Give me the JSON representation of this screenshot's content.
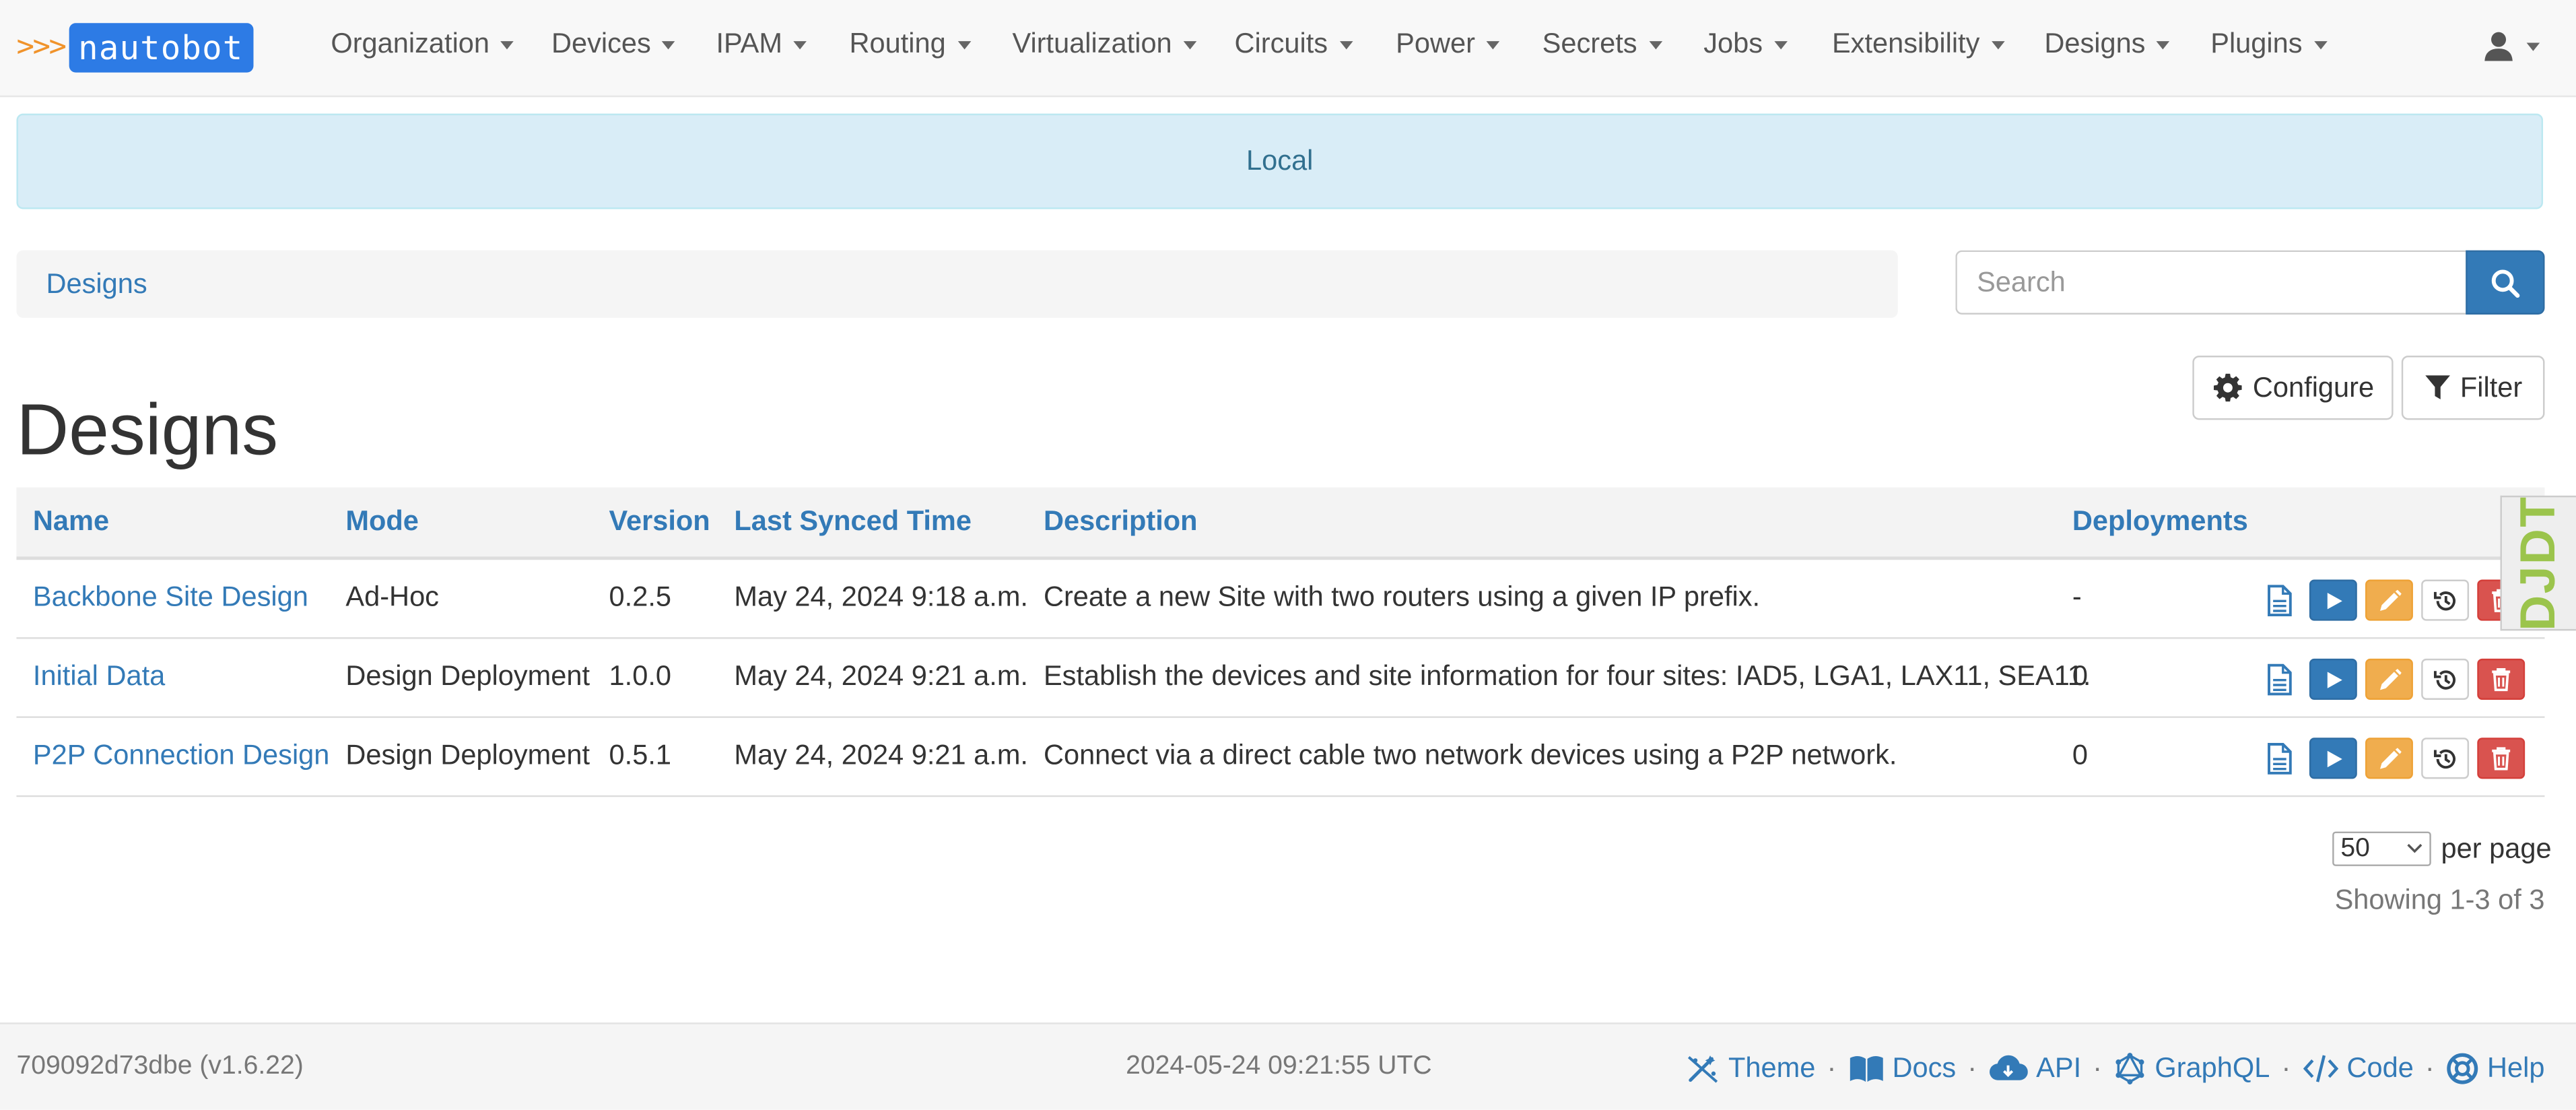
{
  "brand": {
    "arrows": ">>>",
    "name": "nautobot"
  },
  "nav": {
    "items": [
      {
        "label": "Organization"
      },
      {
        "label": "Devices"
      },
      {
        "label": "IPAM"
      },
      {
        "label": "Routing"
      },
      {
        "label": "Virtualization"
      },
      {
        "label": "Circuits"
      },
      {
        "label": "Power"
      },
      {
        "label": "Secrets"
      },
      {
        "label": "Jobs"
      },
      {
        "label": "Extensibility"
      },
      {
        "label": "Designs"
      },
      {
        "label": "Plugins"
      }
    ]
  },
  "banner": {
    "text": "Local"
  },
  "breadcrumb": {
    "items": [
      {
        "label": "Designs"
      }
    ]
  },
  "search": {
    "placeholder": "Search"
  },
  "toolbar": {
    "configure_label": "Configure",
    "filter_label": "Filter"
  },
  "page": {
    "title": "Designs"
  },
  "table": {
    "columns": [
      "Name",
      "Mode",
      "Version",
      "Last Synced Time",
      "Description",
      "Deployments"
    ],
    "rows": [
      {
        "name": "Backbone Site Design",
        "mode": "Ad-Hoc",
        "version": "0.2.5",
        "synced": "May 24, 2024 9:18 a.m.",
        "description": "Create a new Site with two routers using a given IP prefix.",
        "deployments": "-"
      },
      {
        "name": "Initial Data",
        "mode": "Design Deployment",
        "version": "1.0.0",
        "synced": "May 24, 2024 9:21 a.m.",
        "description": "Establish the devices and site information for four sites: IAD5, LGA1, LAX11, SEA11.",
        "deployments": "0"
      },
      {
        "name": "P2P Connection Design",
        "mode": "Design Deployment",
        "version": "0.5.1",
        "synced": "May 24, 2024 9:21 a.m.",
        "description": "Connect via a direct cable two network devices using a P2P network.",
        "deployments": "0"
      }
    ]
  },
  "pagination": {
    "per_page_value": "50",
    "per_page_label": "per page",
    "showing": "Showing 1-3 of 3"
  },
  "djdt": {
    "label": "DJDT"
  },
  "footer": {
    "version": "709092d73dbe (v1.6.22)",
    "timestamp": "2024-05-24 09:21:55 UTC",
    "links": [
      {
        "label": "Theme",
        "icon": "theme-icon"
      },
      {
        "label": "Docs",
        "icon": "book-icon"
      },
      {
        "label": "API",
        "icon": "cloud-icon"
      },
      {
        "label": "GraphQL",
        "icon": "graphql-icon"
      },
      {
        "label": "Code",
        "icon": "code-icon"
      },
      {
        "label": "Help",
        "icon": "lifebuoy-icon"
      }
    ],
    "separator": "·"
  },
  "colors": {
    "primary": "#337ab7",
    "warning": "#f0ad4e",
    "danger": "#d9534f",
    "brand": "#2d7be5",
    "info_bg": "#d9edf7"
  }
}
